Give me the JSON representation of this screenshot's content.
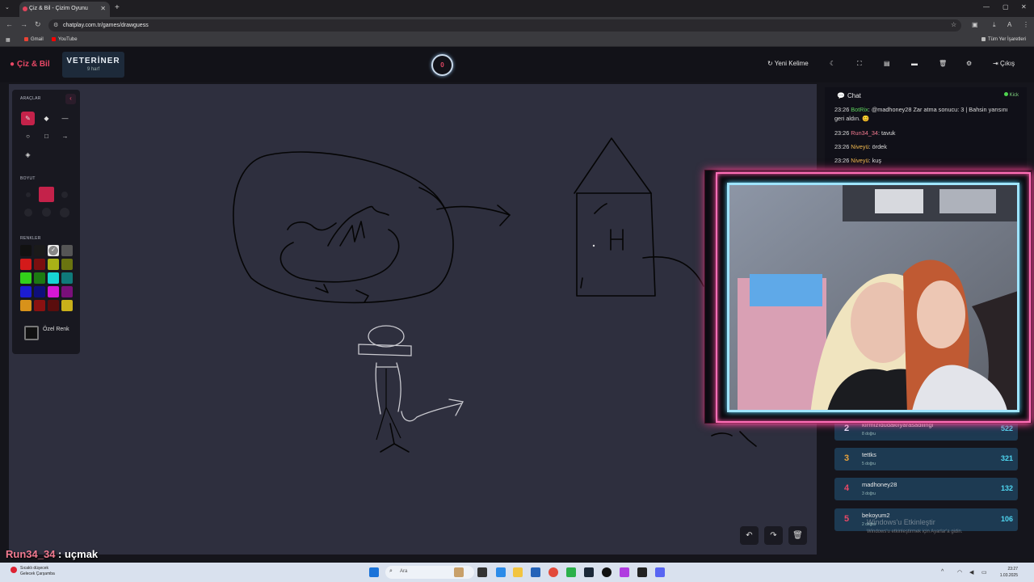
{
  "browser": {
    "tab_title": "Çiz & Bil - Çizim Oyunu",
    "url": "chatplay.com.tr/games/drawguess",
    "bookmarks": [
      {
        "label": "Gmail",
        "color": "#ea4335"
      },
      {
        "label": "YouTube",
        "color": "#ff0000"
      }
    ],
    "all_bookmarks_label": "Tüm Yer İşaretleri",
    "profile_initial": "A"
  },
  "app": {
    "logo": "Çiz & Bil",
    "word": "VETERİNER",
    "word_hint": "9 harf",
    "timer": "0",
    "header_buttons": {
      "new_word": "Yeni Kelime",
      "exit": "Çıkış"
    }
  },
  "tools": {
    "section_tools": "ARAÇLAR",
    "section_size": "BOYUT",
    "section_colors": "RENKLER",
    "custom_color": "Özel Renk",
    "colors": [
      "#111111",
      "#1a1a1a",
      "#e0e0e0",
      "#555555",
      "#d41a1a",
      "#7a0f0f",
      "#a9b217",
      "#6a7410",
      "#32d11a",
      "#1c7a12",
      "#17d4d4",
      "#0f7a7a",
      "#1c1cd1",
      "#0f0f7a",
      "#d417d4",
      "#7a0f7a",
      "#d8921a",
      "#8a1111",
      "#5a0d0d",
      "#c9b01a"
    ],
    "selected_color_index": 2
  },
  "chat": {
    "title": "Chat",
    "platform": "Kick",
    "messages": [
      {
        "time": "23:26",
        "user": "BotRix",
        "user_color": "#5fd45f",
        "text": "@madhoney28 Zar atma sonucu: 3 | Bahsin yarısını geri aldın. 😊"
      },
      {
        "time": "23:26",
        "user": "Run34_34",
        "user_color": "#f27a90",
        "text": "tavuk"
      },
      {
        "time": "23:26",
        "user": "Niveyü",
        "user_color": "#f2b94f",
        "text": "ördek"
      },
      {
        "time": "23:26",
        "user": "Niveyü",
        "user_color": "#f2b94f",
        "text": "kuş"
      }
    ]
  },
  "leaderboard": [
    {
      "rank": "2",
      "name": "kırmızıdudaklıyarasadilingi",
      "sub": "8 doğru",
      "score": "522",
      "rank_color": "#e8e8ff"
    },
    {
      "rank": "3",
      "name": "tettks",
      "sub": "5 doğru",
      "score": "321",
      "rank_color": "#e8a23c"
    },
    {
      "rank": "4",
      "name": "madhoney28",
      "sub": "3 doğru",
      "score": "132",
      "rank_color": "#e84866"
    },
    {
      "rank": "5",
      "name": "bekoyum2",
      "sub": "2 doğru",
      "score": "106",
      "rank_color": "#e84866"
    }
  ],
  "watermark": {
    "title": "Windows'u Etkinleştir",
    "sub": "Windows'u etkinleştirmek için Ayarlar'a gidin."
  },
  "overlay": {
    "user": "Run34_34",
    "guess": " : uçmak"
  },
  "taskbar": {
    "weather_line1": "Sıcaklı düşecek",
    "weather_line2": "Gelecek Çarşamba",
    "search_placeholder": "Ara",
    "time": "23:27",
    "date": "1.03.2025"
  }
}
